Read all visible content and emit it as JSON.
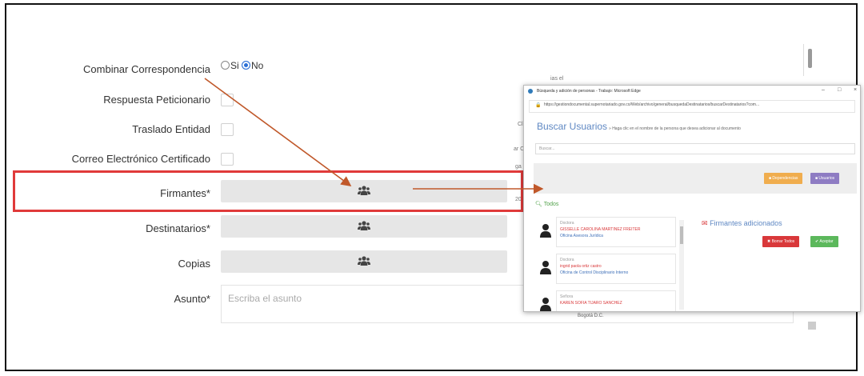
{
  "form": {
    "combinar_label": "Combinar Correspondencia",
    "radio_si": "Si",
    "radio_no": "No",
    "respuesta_label": "Respuesta Peticionario",
    "traslado_label": "Traslado Entidad",
    "correo_label": "Correo Electrónico Certificado",
    "firmantes_label": "Firmantes*",
    "destinatarios_label": "Destinatarios*",
    "copias_label": "Copias",
    "asunto_label": "Asunto*",
    "asunto_placeholder": "Escriba el asunto",
    "bogota_text": "Bogotá D.C."
  },
  "background_fragments": [
    "ias el",
    "Cl",
    "ar C",
    "ga",
    "20"
  ],
  "popup": {
    "window_title": "Búsqueda y adición de personas - Trabajo: Microsoft Edge",
    "window_controls": [
      "–",
      "□",
      "×"
    ],
    "url": "https://gestiondocumental.supernotariado.gov.co/Web/archivo/general/busquedaDestinatarios/buscarDestinatarios?com...",
    "heading": "Buscar Usuarios",
    "hint": "» Haga clic en el nombre de la persona que desea adicionar al documento",
    "search_placeholder": "Buscar...",
    "btn_dependencias": "Dependencias",
    "btn_usuarios": "Usuarios",
    "todos_label": "Todos",
    "people": [
      {
        "title": "Doctora",
        "name": "GISSELLE CAROLINA MARTINEZ FREITER",
        "office": "Oficina Asesora Jurídica"
      },
      {
        "title": "Doctora",
        "name": "ingrid paola ortiz castro",
        "office": "Oficina de Control Disciplinario Interno"
      },
      {
        "title": "Señora",
        "name": "KAREN SOFIA TIJARO SANCHEZ",
        "office": ""
      }
    ],
    "firmantes_heading": "Firmantes adicionados",
    "btn_borrar": "Borrar Todos",
    "btn_aceptar": "Aceptar"
  },
  "colors": {
    "highlight_box": "#e03a3a",
    "arrow": "#c0582a",
    "heading_blue": "#5f88c3",
    "btn_orange": "#f0ad4e",
    "btn_purple": "#8e7cc3",
    "btn_red": "#d9383a",
    "btn_green": "#5cb85c",
    "todos_green": "#52a24b"
  },
  "icons": {
    "group": "users-group-icon",
    "person": "person-icon",
    "envelope": "envelope-icon",
    "search": "search-icon",
    "lock": "lock-icon",
    "edge": "edge-browser-icon"
  }
}
